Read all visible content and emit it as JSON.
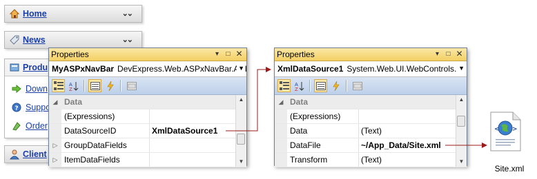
{
  "navbar": {
    "groups": [
      {
        "label": "Home",
        "icon": "home-icon",
        "expanded": false
      },
      {
        "label": "News",
        "icon": "tag-icon",
        "expanded": false
      },
      {
        "label": "Produ",
        "icon": "products-icon",
        "expanded": true,
        "items": [
          {
            "label": "Down",
            "icon": "arrow-right-icon"
          },
          {
            "label": "Suppo",
            "icon": "help-icon"
          },
          {
            "label": "Order",
            "icon": "order-icon"
          }
        ]
      },
      {
        "label": "Client",
        "icon": "user-icon",
        "expanded": false
      }
    ]
  },
  "properties_left": {
    "title": "Properties",
    "object_name": "MyASPxNavBar",
    "object_type": "DevExpress.Web.ASPxNavBar.ASI",
    "category": "Data",
    "rows": [
      {
        "name": "(Expressions)",
        "value": ""
      },
      {
        "name": "DataSourceID",
        "value": "XmlDataSource1",
        "bold": true
      },
      {
        "name": "GroupDataFields",
        "value": "",
        "expandable": true
      },
      {
        "name": "ItemDataFields",
        "value": "",
        "expandable": true
      }
    ]
  },
  "properties_right": {
    "title": "Properties",
    "object_name": "XmlDataSource1",
    "object_type": "System.Web.UI.WebControls.X",
    "category": "Data",
    "rows": [
      {
        "name": "(Expressions)",
        "value": ""
      },
      {
        "name": "Data",
        "value": "(Text)"
      },
      {
        "name": "DataFile",
        "value": "~/App_Data/Site.xml",
        "bold": true
      },
      {
        "name": "Transform",
        "value": "(Text)"
      }
    ]
  },
  "file": {
    "label": "Site.xml"
  },
  "colors": {
    "accent_arrow": "#9b1b1b",
    "title_bar": "#f3cf63",
    "link": "#1a3fa8"
  }
}
